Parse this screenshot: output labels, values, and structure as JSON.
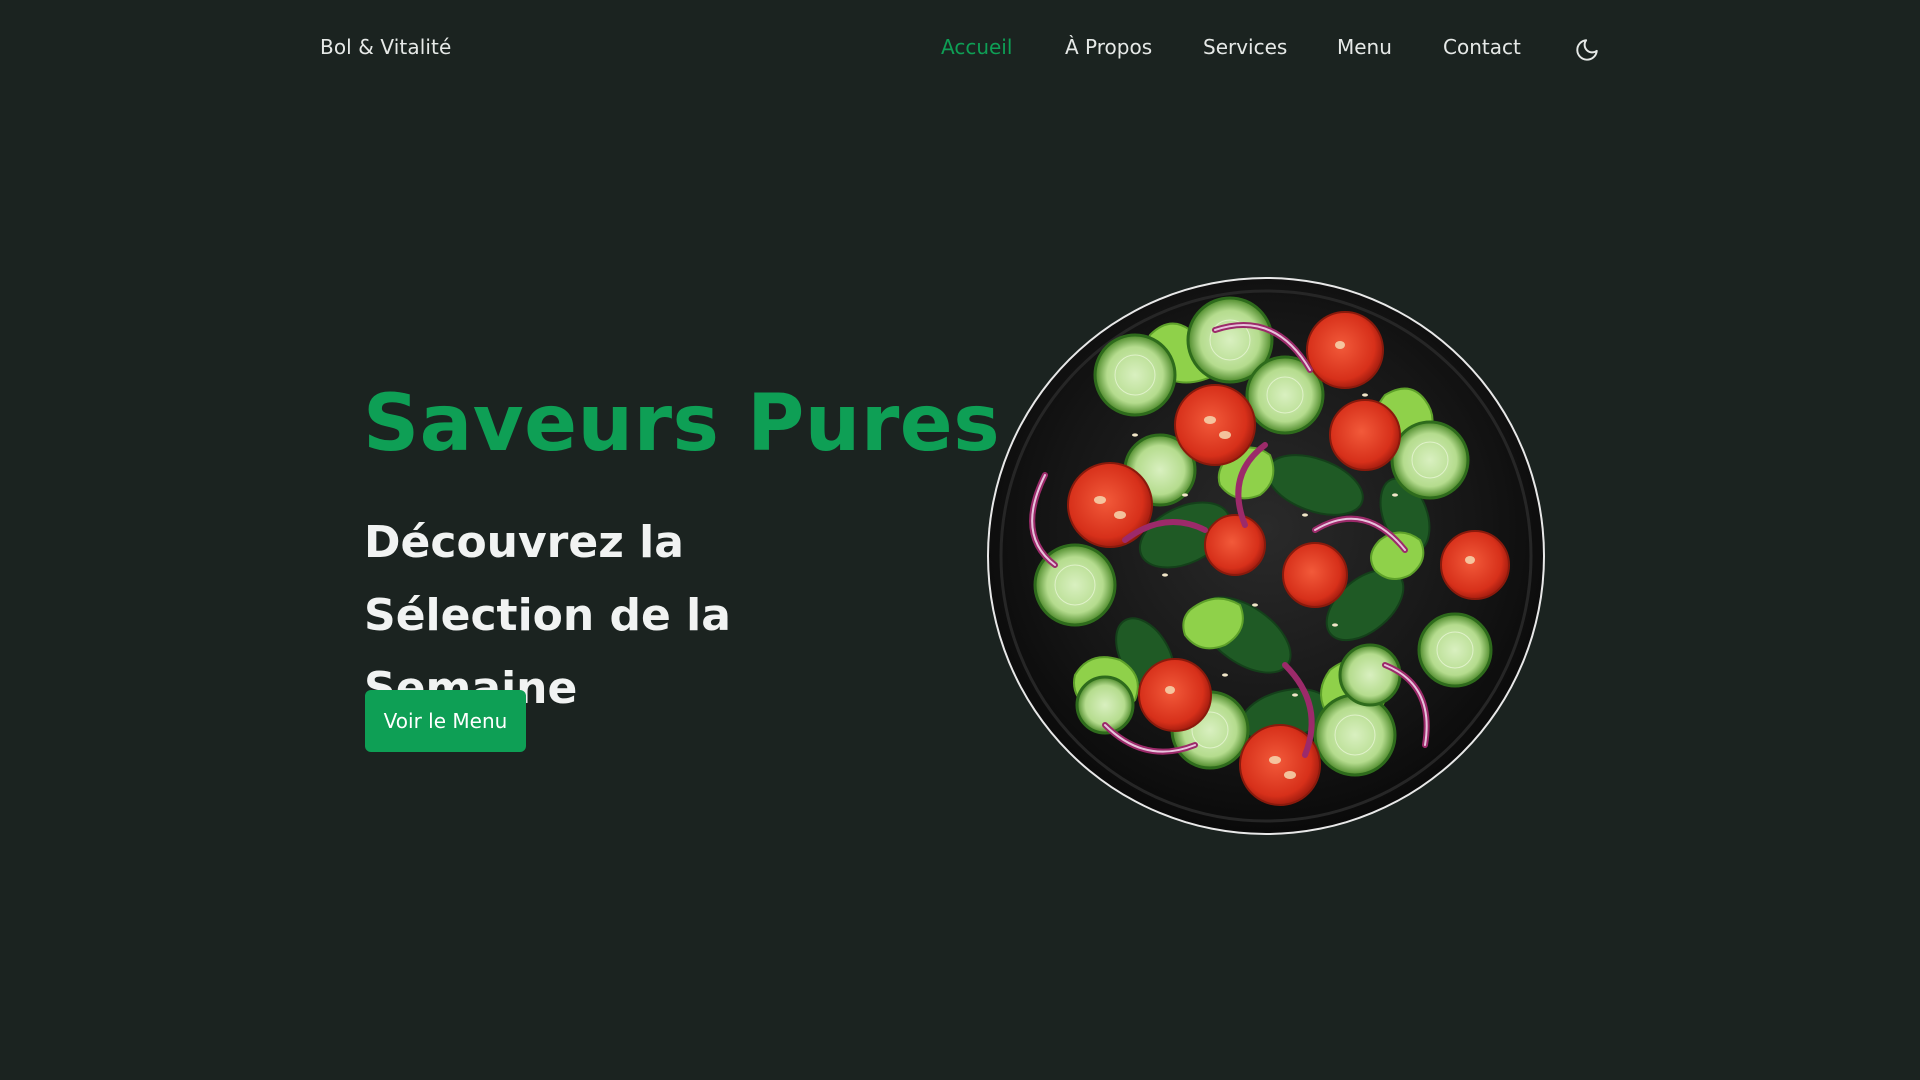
{
  "header": {
    "logo": "Bol & Vitalité",
    "nav": [
      {
        "label": "Accueil",
        "active": true
      },
      {
        "label": "À Propos",
        "active": false
      },
      {
        "label": "Services",
        "active": false
      },
      {
        "label": "Menu",
        "active": false
      },
      {
        "label": "Contact",
        "active": false
      }
    ],
    "theme_toggle_icon": "moon-icon"
  },
  "hero": {
    "title": "Saveurs Pures",
    "subtitle": "Découvrez la Sélection de la Semaine",
    "cta_label": "Voir le Menu",
    "image_icon": "salad-bowl-image"
  },
  "colors": {
    "background": "#1b2320",
    "accent": "#0e9f55",
    "text": "#e6e9e7"
  }
}
